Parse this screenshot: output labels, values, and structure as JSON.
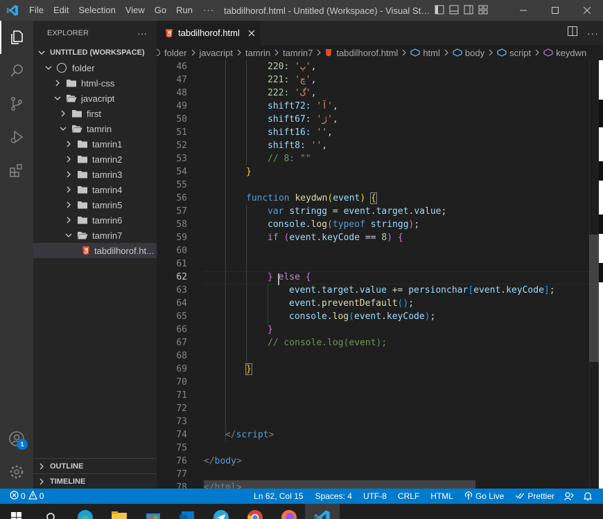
{
  "window": {
    "title": "tabdilhorof.html - Untitled (Workspace) - Visual Studio ...",
    "menu": [
      "File",
      "Edit",
      "Selection",
      "View",
      "Go",
      "Run"
    ],
    "more": "···"
  },
  "sidebar": {
    "title": "EXPLORER",
    "more": "···",
    "workspace": "UNTITLED (WORKSPACE)",
    "folder": "folder",
    "items": [
      {
        "label": "html-css",
        "level": 2,
        "open": false
      },
      {
        "label": "javacript",
        "level": 2,
        "open": true
      },
      {
        "label": "first",
        "level": 3,
        "open": false
      },
      {
        "label": "tamrin",
        "level": 3,
        "open": true
      },
      {
        "label": "tamrin1",
        "level": 4,
        "open": false
      },
      {
        "label": "tamrin2",
        "level": 4,
        "open": false
      },
      {
        "label": "tamrin3",
        "level": 4,
        "open": false
      },
      {
        "label": "tamrin4",
        "level": 4,
        "open": false
      },
      {
        "label": "tamrin5",
        "level": 4,
        "open": false
      },
      {
        "label": "tamrin6",
        "level": 4,
        "open": false
      },
      {
        "label": "tamrin7",
        "level": 4,
        "open": true
      }
    ],
    "file": "tabdilhorof.ht...",
    "outline": "OUTLINE",
    "timeline": "TIMELINE"
  },
  "tab": {
    "label": "tabdilhorof.html"
  },
  "breadcrumb": [
    "folder",
    "javacript",
    "tamrin",
    "tamrin7",
    "tabdilhorof.html",
    "html",
    "body",
    "script",
    "keydwn"
  ],
  "editor": {
    "line_numbers": [
      "46",
      "47",
      "48",
      "49",
      "50",
      "51",
      "52",
      "53",
      "54",
      "55",
      "56",
      "57",
      "58",
      "59",
      "60",
      "61",
      "62",
      "63",
      "64",
      "65",
      "66",
      "67",
      "68",
      "69",
      "70",
      "71",
      "72",
      "73",
      "74",
      "75",
      "76",
      "77",
      "78"
    ],
    "current_line": "62",
    "lines": {
      "l46_key": "220: ",
      "l46_val": "'پ'",
      "l47_key": "221: ",
      "l47_val": "'چ'",
      "l48_key": "222: ",
      "l48_val": "'گ'",
      "l49_key": "shift72: ",
      "l49_val": "'آ'",
      "l50_key": "shift67: ",
      "l50_val": "'ژ'",
      "l51_key": "shift16: ",
      "l51_val": "''",
      "l52_key": "shift8: ",
      "l52_val": "''",
      "l53": "// 8: \"\"",
      "l56_kw": "function",
      "l56_fn": "keydwn",
      "l56_param": "event",
      "l57_kw": "var",
      "l57_var": "stringg",
      "l57_rhs1": "event",
      "l57_rhs2": "target",
      "l57_rhs3": "value",
      "l58_obj": "console",
      "l58_fn": "log",
      "l58_kw": "typeof",
      "l58_arg": "stringg",
      "l59_kw": "if",
      "l59_a": "event",
      "l59_b": "keyCode",
      "l59_op": " == ",
      "l59_num": "8",
      "l62_kw": "else",
      "l63_a": "event",
      "l63_b": "target",
      "l63_c": "value",
      "l63_op": " += ",
      "l63_d": "persionchar",
      "l63_e": "event",
      "l63_f": "keyCode",
      "l64_a": "event",
      "l64_fn": "preventDefault",
      "l65_obj": "console",
      "l65_fn": "log",
      "l65_a": "event",
      "l65_b": "keyCode",
      "l67": "// console.log(event);",
      "l74_tag": "script",
      "l76_tag": "body",
      "l78": "</html>"
    }
  },
  "statusbar": {
    "errors": "0",
    "warnings": "0",
    "position": "Ln 62, Col 15",
    "spaces": "Spaces: 4",
    "encoding": "UTF-8",
    "eol": "CRLF",
    "language": "HTML",
    "golive": "Go Live",
    "prettier": "Prettier"
  },
  "accounts_badge": "1",
  "colors": {
    "accent": "#007acc",
    "keyword": "#569cd6",
    "control": "#c586c0",
    "function": "#dcdcaa",
    "variable": "#9cdcfe",
    "string": "#ce9178",
    "comment": "#6a9955"
  }
}
